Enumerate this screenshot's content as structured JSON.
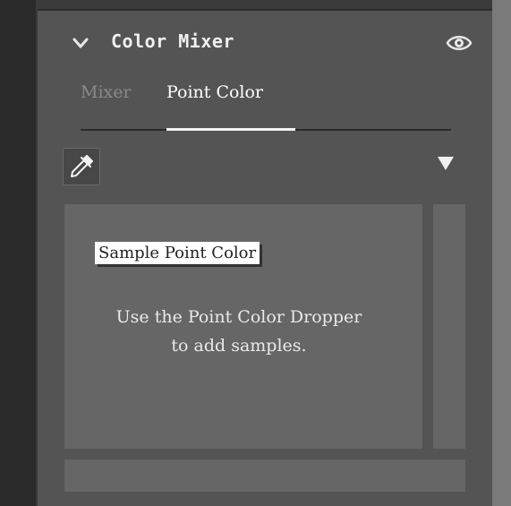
{
  "panel": {
    "title": "Color Mixer"
  },
  "tabs": [
    {
      "label": "Mixer",
      "active": false
    },
    {
      "label": "Point Color",
      "active": true
    }
  ],
  "toolbar": {
    "dropper_icon": "eyedropper-icon",
    "menu_icon": "triangle-down-icon"
  },
  "samples": {
    "tooltip": "Sample Point Color",
    "hint_line1": "Use the Point Color Dropper",
    "hint_line2": "to add samples."
  },
  "colors": {
    "panel_bg": "#545454",
    "well_bg": "#666666",
    "active_tab": "#ffffff",
    "inactive_tab": "#8a8a8a"
  }
}
